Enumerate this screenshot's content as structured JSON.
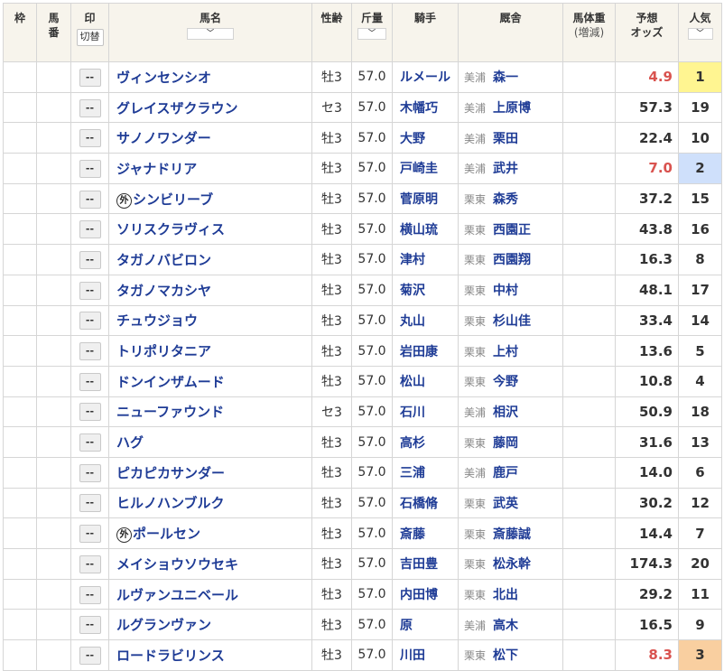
{
  "headers": {
    "waku": "枠",
    "umaban_1": "馬",
    "umaban_2": "番",
    "mark": "印",
    "swap": "切替",
    "horse": "馬名",
    "sexage": "性齢",
    "weight": "斤量",
    "jockey": "騎手",
    "stable": "厩舎",
    "bodyweight_1": "馬体重",
    "bodyweight_2": "(増減)",
    "odds_1": "予想",
    "odds_2": "オッズ",
    "popularity": "人気"
  },
  "mark_placeholder": "--",
  "foreign_badge": "外",
  "rows": [
    {
      "horse": "ヴィンセンシオ",
      "foreign": false,
      "sexage": "牡3",
      "weight": "57.0",
      "jockey": "ルメール",
      "loc": "美浦",
      "trainer": "森一",
      "odds": "4.9",
      "pop": "1"
    },
    {
      "horse": "グレイスザクラウン",
      "foreign": false,
      "sexage": "セ3",
      "weight": "57.0",
      "jockey": "木幡巧",
      "loc": "美浦",
      "trainer": "上原博",
      "odds": "57.3",
      "pop": "19"
    },
    {
      "horse": "サノノワンダー",
      "foreign": false,
      "sexage": "牡3",
      "weight": "57.0",
      "jockey": "大野",
      "loc": "美浦",
      "trainer": "栗田",
      "odds": "22.4",
      "pop": "10"
    },
    {
      "horse": "ジャナドリア",
      "foreign": false,
      "sexage": "牡3",
      "weight": "57.0",
      "jockey": "戸崎圭",
      "loc": "美浦",
      "trainer": "武井",
      "odds": "7.0",
      "pop": "2"
    },
    {
      "horse": "シンビリーブ",
      "foreign": true,
      "sexage": "牡3",
      "weight": "57.0",
      "jockey": "菅原明",
      "loc": "栗東",
      "trainer": "森秀",
      "odds": "37.2",
      "pop": "15"
    },
    {
      "horse": "ソリスクラヴィス",
      "foreign": false,
      "sexage": "牡3",
      "weight": "57.0",
      "jockey": "横山琉",
      "loc": "栗東",
      "trainer": "西園正",
      "odds": "43.8",
      "pop": "16"
    },
    {
      "horse": "タガノバビロン",
      "foreign": false,
      "sexage": "牡3",
      "weight": "57.0",
      "jockey": "津村",
      "loc": "栗東",
      "trainer": "西園翔",
      "odds": "16.3",
      "pop": "8"
    },
    {
      "horse": "タガノマカシヤ",
      "foreign": false,
      "sexage": "牡3",
      "weight": "57.0",
      "jockey": "菊沢",
      "loc": "栗東",
      "trainer": "中村",
      "odds": "48.1",
      "pop": "17"
    },
    {
      "horse": "チュウジョウ",
      "foreign": false,
      "sexage": "牡3",
      "weight": "57.0",
      "jockey": "丸山",
      "loc": "栗東",
      "trainer": "杉山佳",
      "odds": "33.4",
      "pop": "14"
    },
    {
      "horse": "トリポリタニア",
      "foreign": false,
      "sexage": "牡3",
      "weight": "57.0",
      "jockey": "岩田康",
      "loc": "栗東",
      "trainer": "上村",
      "odds": "13.6",
      "pop": "5"
    },
    {
      "horse": "ドンインザムード",
      "foreign": false,
      "sexage": "牡3",
      "weight": "57.0",
      "jockey": "松山",
      "loc": "栗東",
      "trainer": "今野",
      "odds": "10.8",
      "pop": "4"
    },
    {
      "horse": "ニューファウンド",
      "foreign": false,
      "sexage": "セ3",
      "weight": "57.0",
      "jockey": "石川",
      "loc": "美浦",
      "trainer": "相沢",
      "odds": "50.9",
      "pop": "18"
    },
    {
      "horse": "ハグ",
      "foreign": false,
      "sexage": "牡3",
      "weight": "57.0",
      "jockey": "高杉",
      "loc": "栗東",
      "trainer": "藤岡",
      "odds": "31.6",
      "pop": "13"
    },
    {
      "horse": "ピカピカサンダー",
      "foreign": false,
      "sexage": "牡3",
      "weight": "57.0",
      "jockey": "三浦",
      "loc": "美浦",
      "trainer": "鹿戸",
      "odds": "14.0",
      "pop": "6"
    },
    {
      "horse": "ヒルノハンブルク",
      "foreign": false,
      "sexage": "牡3",
      "weight": "57.0",
      "jockey": "石橋脩",
      "loc": "栗東",
      "trainer": "武英",
      "odds": "30.2",
      "pop": "12"
    },
    {
      "horse": "ポールセン",
      "foreign": true,
      "sexage": "牡3",
      "weight": "57.0",
      "jockey": "斎藤",
      "loc": "栗東",
      "trainer": "斎藤誠",
      "odds": "14.4",
      "pop": "7"
    },
    {
      "horse": "メイショウソウセキ",
      "foreign": false,
      "sexage": "牡3",
      "weight": "57.0",
      "jockey": "吉田豊",
      "loc": "栗東",
      "trainer": "松永幹",
      "odds": "174.3",
      "pop": "20"
    },
    {
      "horse": "ルヴァンユニベール",
      "foreign": false,
      "sexage": "牡3",
      "weight": "57.0",
      "jockey": "内田博",
      "loc": "栗東",
      "trainer": "北出",
      "odds": "29.2",
      "pop": "11"
    },
    {
      "horse": "ルグランヴァン",
      "foreign": false,
      "sexage": "牡3",
      "weight": "57.0",
      "jockey": "原",
      "loc": "美浦",
      "trainer": "高木",
      "odds": "16.5",
      "pop": "9"
    },
    {
      "horse": "ロードラビリンス",
      "foreign": false,
      "sexage": "牡3",
      "weight": "57.0",
      "jockey": "川田",
      "loc": "栗東",
      "trainer": "松下",
      "odds": "8.3",
      "pop": "3"
    }
  ],
  "colors": {
    "horse_link": "#1f3c96",
    "hot_odds": "#d9534f",
    "pop1_bg": "#fff591",
    "pop2_bg": "#cfe0fb",
    "pop3_bg": "#f9cfa0",
    "header_bg": "#f7f4ec"
  }
}
